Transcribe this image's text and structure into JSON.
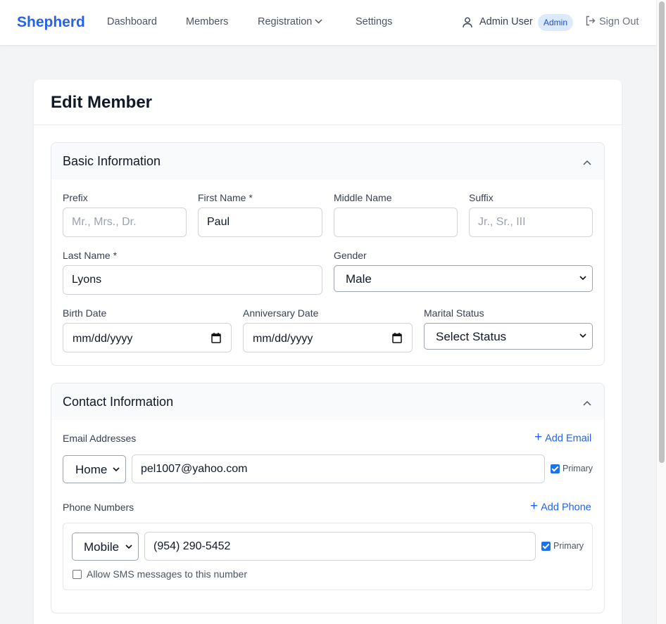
{
  "nav": {
    "brand": "Shepherd",
    "links": [
      "Dashboard",
      "Members",
      "Registration",
      "Settings"
    ],
    "user_name": "Admin User",
    "role": "Admin",
    "sign_out": "Sign Out"
  },
  "page": {
    "title": "Edit Member"
  },
  "basic": {
    "title": "Basic Information",
    "prefix": {
      "label": "Prefix",
      "placeholder": "Mr., Mrs., Dr.",
      "value": ""
    },
    "first_name": {
      "label": "First Name *",
      "value": "Paul"
    },
    "middle_name": {
      "label": "Middle Name",
      "value": ""
    },
    "suffix": {
      "label": "Suffix",
      "placeholder": "Jr., Sr., III",
      "value": ""
    },
    "last_name": {
      "label": "Last Name *",
      "value": "Lyons"
    },
    "gender": {
      "label": "Gender",
      "value": "Male"
    },
    "birth_date": {
      "label": "Birth Date",
      "value": "mm/dd/yyyy"
    },
    "anniversary_date": {
      "label": "Anniversary Date",
      "value": "mm/dd/yyyy"
    },
    "marital_status": {
      "label": "Marital Status",
      "value": "Select Status"
    }
  },
  "contact": {
    "title": "Contact Information",
    "emails_label": "Email Addresses",
    "add_email": "Add Email",
    "email": {
      "type": "Home",
      "value": "pel1007@yahoo.com",
      "primary_label": "Primary",
      "primary": true
    },
    "phones_label": "Phone Numbers",
    "add_phone": "Add Phone",
    "phone": {
      "type": "Mobile",
      "value": "(954) 290-5452",
      "primary_label": "Primary",
      "primary": true,
      "sms_label": "Allow SMS messages to this number",
      "sms": false
    }
  },
  "colors": {
    "accent": "#2563eb",
    "badge_bg": "#dbeafe",
    "checkbox": "#1a73e8"
  }
}
